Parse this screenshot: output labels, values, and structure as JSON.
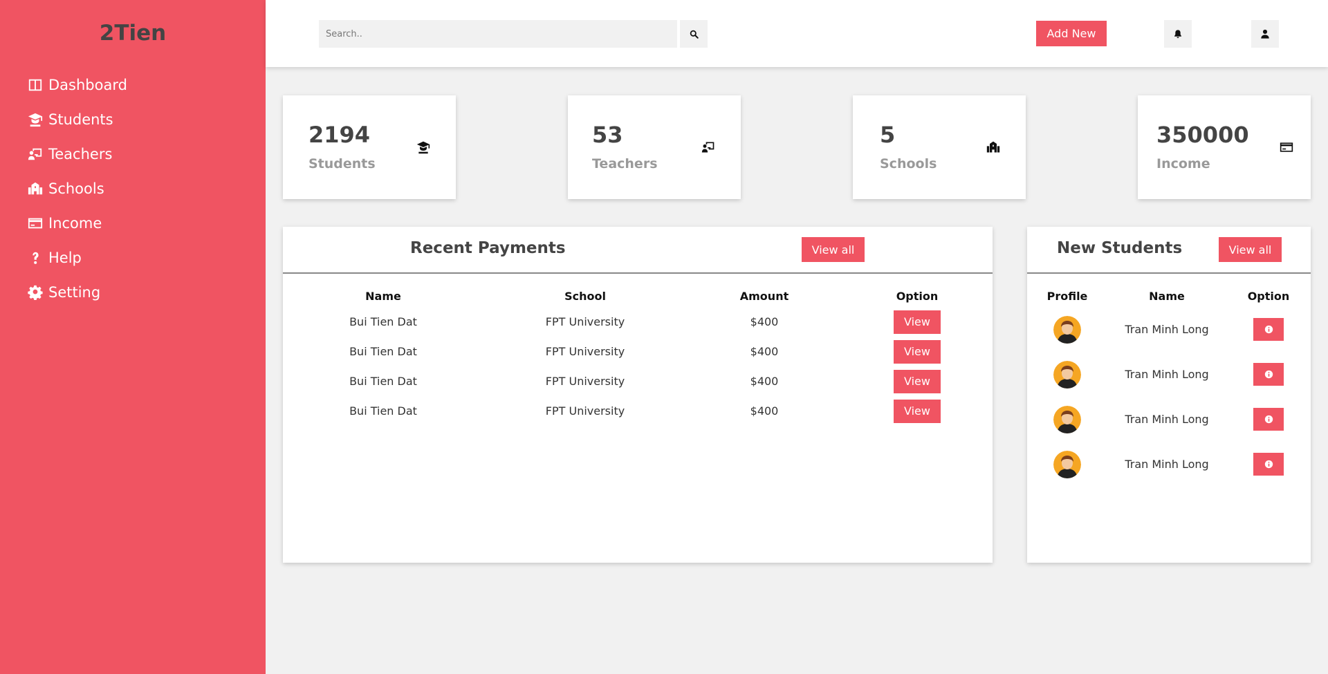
{
  "brand": "2Tien",
  "colors": {
    "accent": "#f05462",
    "background": "#f1f1f1",
    "text_dark": "#444444",
    "text_muted": "#999999"
  },
  "sidebar": {
    "items": [
      {
        "label": "Dashboard",
        "icon": "dashboard-icon"
      },
      {
        "label": "Students",
        "icon": "graduate-icon"
      },
      {
        "label": "Teachers",
        "icon": "teacher-icon"
      },
      {
        "label": "Schools",
        "icon": "school-icon"
      },
      {
        "label": "Income",
        "icon": "credit-card-icon"
      },
      {
        "label": "Help",
        "icon": "question-icon"
      },
      {
        "label": "Setting",
        "icon": "gear-icon"
      }
    ]
  },
  "topbar": {
    "search_placeholder": "Search..",
    "add_new_label": "Add New"
  },
  "stats": [
    {
      "value": "2194",
      "label": "Students",
      "icon": "graduate-icon"
    },
    {
      "value": "53",
      "label": "Teachers",
      "icon": "teacher-icon"
    },
    {
      "value": "5",
      "label": "Schools",
      "icon": "school-icon"
    },
    {
      "value": "350000",
      "label": "Income",
      "icon": "credit-card-icon"
    }
  ],
  "payments": {
    "title": "Recent Payments",
    "view_all_label": "View all",
    "columns": [
      "Name",
      "School",
      "Amount",
      "Option"
    ],
    "rows": [
      {
        "name": "Bui Tien Dat",
        "school": "FPT University",
        "amount": "$400",
        "option": "View"
      },
      {
        "name": "Bui Tien Dat",
        "school": "FPT University",
        "amount": "$400",
        "option": "View"
      },
      {
        "name": "Bui Tien Dat",
        "school": "FPT University",
        "amount": "$400",
        "option": "View"
      },
      {
        "name": "Bui Tien Dat",
        "school": "FPT University",
        "amount": "$400",
        "option": "View"
      }
    ]
  },
  "new_students": {
    "title": "New Students",
    "view_all_label": "View all",
    "columns": [
      "Profile",
      "Name",
      "Option"
    ],
    "rows": [
      {
        "name": "Tran Minh Long",
        "icon": "info-icon"
      },
      {
        "name": "Tran Minh Long",
        "icon": "info-icon"
      },
      {
        "name": "Tran Minh Long",
        "icon": "info-icon"
      },
      {
        "name": "Tran Minh Long",
        "icon": "info-icon"
      }
    ]
  }
}
